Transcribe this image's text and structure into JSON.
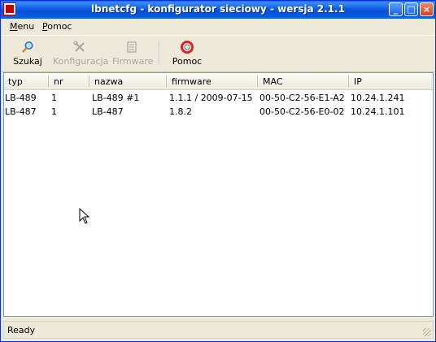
{
  "window": {
    "title": "lbnetcfg - konfigurator sieciowy - wersja 2.1.1",
    "minimize": "_",
    "maximize": "□",
    "close": "×"
  },
  "menubar": {
    "menu_first": "M",
    "menu_rest": "enu",
    "help_first": "P",
    "help_rest": "omoc"
  },
  "toolbar": {
    "search_label": "Szukaj",
    "config_label": "Konfiguracja",
    "firmware_label": "Firmware",
    "help_label": "Pomoc"
  },
  "table": {
    "columns": [
      "typ",
      "nr",
      "nazwa",
      "firmware",
      "MAC",
      "IP"
    ],
    "rows": [
      [
        "LB-489",
        "1",
        "LB-489 #1",
        "1.1.1 / 2009-07-15",
        "00-50-C2-56-E1-A2",
        "10.24.1.241"
      ],
      [
        "LB-487",
        "1",
        "LB-487",
        "1.8.2",
        "00-50-C2-56-E0-02",
        "10.24.1.101"
      ]
    ]
  },
  "status": {
    "text": "Ready"
  },
  "colors": {
    "titlebar": "#0b5ee4",
    "window_bg": "#ece9d8",
    "disabled_text": "#a9a79c"
  }
}
